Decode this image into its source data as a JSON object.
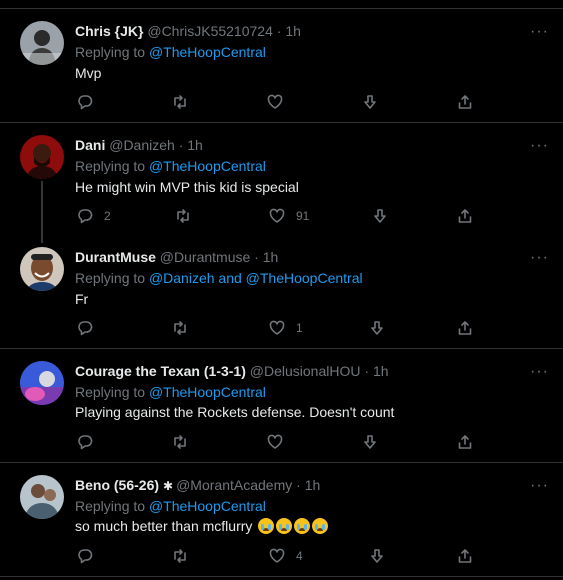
{
  "tweets": [
    {
      "name": "Chris {JK}",
      "handle": "@ChrisJK55210724",
      "time": "1h",
      "replying_prefix": "Replying to",
      "replying_to": "@TheHoopCentral",
      "text": "Mvp",
      "replies": "",
      "retweets": "",
      "likes": ""
    },
    {
      "name": "Dani",
      "handle": "@Danizeh",
      "time": "1h",
      "replying_prefix": "Replying to",
      "replying_to": "@TheHoopCentral",
      "text": "He might win MVP this kid is special",
      "replies": "2",
      "retweets": "",
      "likes": "91"
    },
    {
      "name": "DurantMuse",
      "handle": "@Durantmuse",
      "time": "1h",
      "replying_prefix": "Replying to",
      "replying_to": "@Danizeh and @TheHoopCentral",
      "text": "Fr",
      "replies": "",
      "retweets": "",
      "likes": "1"
    },
    {
      "name": "Courage the Texan (1-3-1)",
      "handle": "@DelusionalHOU",
      "time": "1h",
      "replying_prefix": "Replying to",
      "replying_to": "@TheHoopCentral",
      "text": "Playing against the Rockets defense. Doesn't count",
      "replies": "",
      "retweets": "",
      "likes": ""
    },
    {
      "name": "Beno (56-26)",
      "handle": "@MorantAcademy",
      "time": "1h",
      "replying_prefix": "Replying to",
      "replying_to": "@TheHoopCentral",
      "text": "so much better than mcflurry",
      "replies": "",
      "retweets": "",
      "likes": "4"
    }
  ],
  "separator": "·",
  "more_glyph": "···",
  "colors": {
    "background": "#000000",
    "link": "#1d9bf0",
    "muted": "#71767b",
    "text": "#e7e9ea"
  },
  "icons": [
    "reply-icon",
    "retweet-icon",
    "like-icon",
    "downvote-icon",
    "share-icon",
    "more-icon"
  ]
}
